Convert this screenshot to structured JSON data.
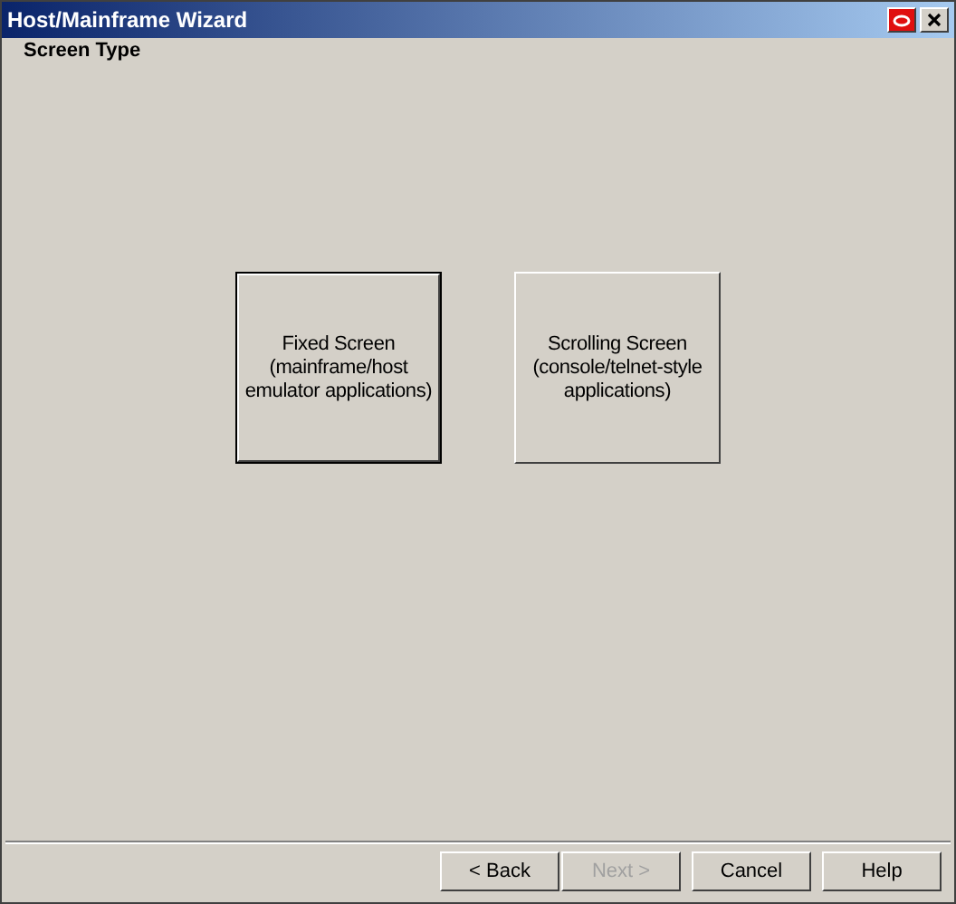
{
  "window": {
    "title": "Host/Mainframe Wizard"
  },
  "page_title": "Screen Type",
  "choices": [
    {
      "lines": [
        "Fixed Screen",
        "(mainframe/host",
        "emulator applications)"
      ],
      "selected": true
    },
    {
      "lines": [
        "Scrolling Screen",
        "(console/telnet-style",
        "applications)"
      ],
      "selected": false
    }
  ],
  "buttons": [
    {
      "label": "< Back",
      "disabled": false
    },
    {
      "label": "Next >",
      "disabled": true
    },
    {
      "label": "Cancel",
      "disabled": false
    },
    {
      "label": "Help",
      "disabled": false
    }
  ]
}
